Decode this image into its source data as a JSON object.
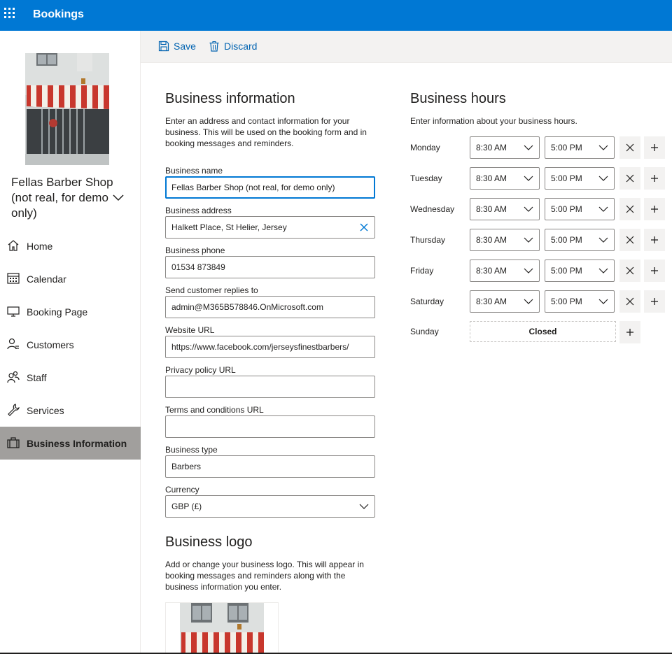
{
  "app": {
    "title": "Bookings"
  },
  "sidebar": {
    "shop_name": "Fellas Barber Shop (not real, for demo only)",
    "items": [
      {
        "label": "Home",
        "icon": "home-icon"
      },
      {
        "label": "Calendar",
        "icon": "calendar-icon"
      },
      {
        "label": "Booking Page",
        "icon": "monitor-icon"
      },
      {
        "label": "Customers",
        "icon": "customers-icon"
      },
      {
        "label": "Staff",
        "icon": "staff-icon"
      },
      {
        "label": "Services",
        "icon": "wrench-icon"
      },
      {
        "label": "Business Information",
        "icon": "briefcase-icon",
        "active": true
      }
    ]
  },
  "commands": {
    "save": "Save",
    "discard": "Discard"
  },
  "business_info": {
    "title": "Business information",
    "description": "Enter an address and contact information for your business. This will be used on the booking form and in booking messages and reminders.",
    "fields": {
      "name": {
        "label": "Business name",
        "value": "Fellas Barber Shop (not real, for demo only)"
      },
      "address": {
        "label": "Business address",
        "value": "Halkett Place, St Helier, Jersey"
      },
      "phone": {
        "label": "Business phone",
        "value": "01534 873849"
      },
      "replies": {
        "label": "Send customer replies to",
        "value": "admin@M365B578846.OnMicrosoft.com"
      },
      "website": {
        "label": "Website URL",
        "value": "https://www.facebook.com/jerseysfinestbarbers/"
      },
      "privacy": {
        "label": "Privacy policy URL",
        "value": ""
      },
      "terms": {
        "label": "Terms and conditions URL",
        "value": ""
      },
      "type": {
        "label": "Business type",
        "value": "Barbers"
      },
      "currency": {
        "label": "Currency",
        "value": "GBP (£)"
      }
    }
  },
  "business_logo": {
    "title": "Business logo",
    "description": "Add or change your business logo. This will appear in booking messages and reminders along with the business information you enter."
  },
  "business_hours": {
    "title": "Business hours",
    "description": "Enter information about your business hours.",
    "days": [
      {
        "day": "Monday",
        "open": "8:30 AM",
        "close": "5:00 PM"
      },
      {
        "day": "Tuesday",
        "open": "8:30 AM",
        "close": "5:00 PM"
      },
      {
        "day": "Wednesday",
        "open": "8:30 AM",
        "close": "5:00 PM"
      },
      {
        "day": "Thursday",
        "open": "8:30 AM",
        "close": "5:00 PM"
      },
      {
        "day": "Friday",
        "open": "8:30 AM",
        "close": "5:00 PM"
      },
      {
        "day": "Saturday",
        "open": "8:30 AM",
        "close": "5:00 PM"
      }
    ],
    "sunday": {
      "day": "Sunday",
      "status": "Closed"
    }
  },
  "colors": {
    "brand": "#0078d4",
    "link": "#0063b1",
    "active_nav": "#a19f9d"
  }
}
